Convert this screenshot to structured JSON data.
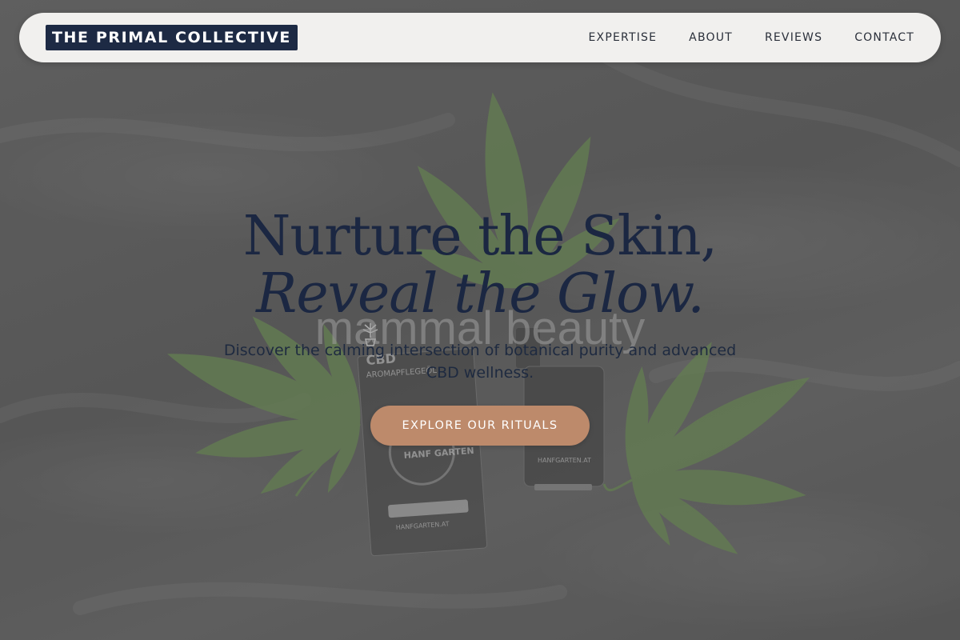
{
  "header": {
    "logo_text": "THE PRIMAL COLLECTIVE",
    "nav": [
      {
        "label": "EXPERTISE"
      },
      {
        "label": "ABOUT"
      },
      {
        "label": "REVIEWS"
      },
      {
        "label": "CONTACT"
      }
    ]
  },
  "hero": {
    "headline_line1": "Nurture the Skin,",
    "headline_line2": "Reveal the Glow.",
    "brand_watermark": "mammal beauty",
    "subtitle": "Discover the calming intersection of botanical purity and advanced CBD wellness.",
    "cta_label": "EXPLORE OUR RITUALS",
    "product_image": {
      "box_label_top": "CBD",
      "box_label_sub": "AROMAPFLEGEÖL",
      "box_badge": "HANF GARTEN",
      "box_footer": "HANFGARTEN.AT",
      "bottle_label": "HANFGARTEN.AT"
    }
  },
  "colors": {
    "nav_background": "#f1f0ee",
    "logo_background": "#1d2a44",
    "headline": "#1b2742",
    "cta_background": "#bd8a6b",
    "leaf_green": "#5f7d4a"
  },
  "icons": {
    "leaf": "cannabis-leaf-icon",
    "box_logo": "plant-pot-icon"
  }
}
